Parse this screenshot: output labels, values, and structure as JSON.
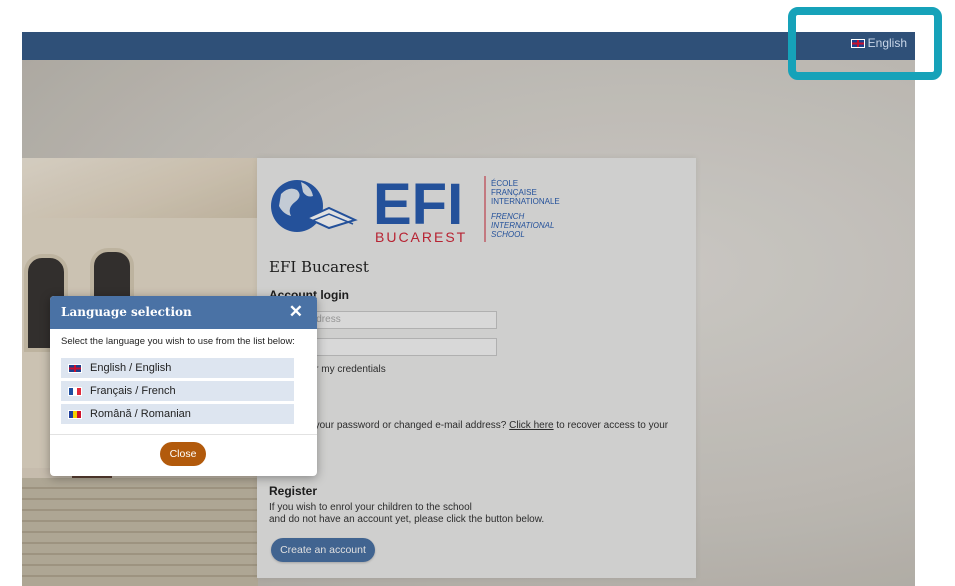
{
  "topbar": {
    "language_label": "English",
    "language_flag_icon": "uk-flag-icon"
  },
  "card": {
    "logo": {
      "brand": "EFI",
      "city": "BUCAREST",
      "fr_line1": "ÉCOLE",
      "fr_line2": "FRANÇAISE",
      "fr_line3": "INTERNATIONALE",
      "en_line1": "FRENCH",
      "en_line2": "INTERNATIONAL",
      "en_line3": "SCHOOL"
    },
    "title": "EFI Bucarest",
    "account_login": "Account login",
    "email_placeholder": "E-mail address",
    "remember_text": "Remember my credentials",
    "forgot_text": "Forgotten your password or changed e-mail address?",
    "forgot_link": "Click here",
    "forgot_suffix": "to recover access to your",
    "register_title": "Register",
    "register_line1": "If you wish to enrol your children to the school",
    "register_line2": "and do not have an account yet, please click the button below.",
    "create_account_label": "Create an account"
  },
  "modal": {
    "title": "Language selection",
    "prompt": "Select the language you wish to use from the list below:",
    "languages": [
      {
        "label": "English / English",
        "flag": "uk-flag-icon"
      },
      {
        "label": "Français / French",
        "flag": "france-flag-icon"
      },
      {
        "label": "Română / Romanian",
        "flag": "romania-flag-icon"
      }
    ],
    "close_label": "Close",
    "close_icon": "close-icon"
  },
  "colors": {
    "topbar": "#2f5078",
    "modal_header": "#4a72a5",
    "close_button": "#b25a0c",
    "create_button": "#4b72a4",
    "highlight": "#16a2b9",
    "logo_blue": "#2a5db0",
    "logo_red": "#d1283a"
  }
}
